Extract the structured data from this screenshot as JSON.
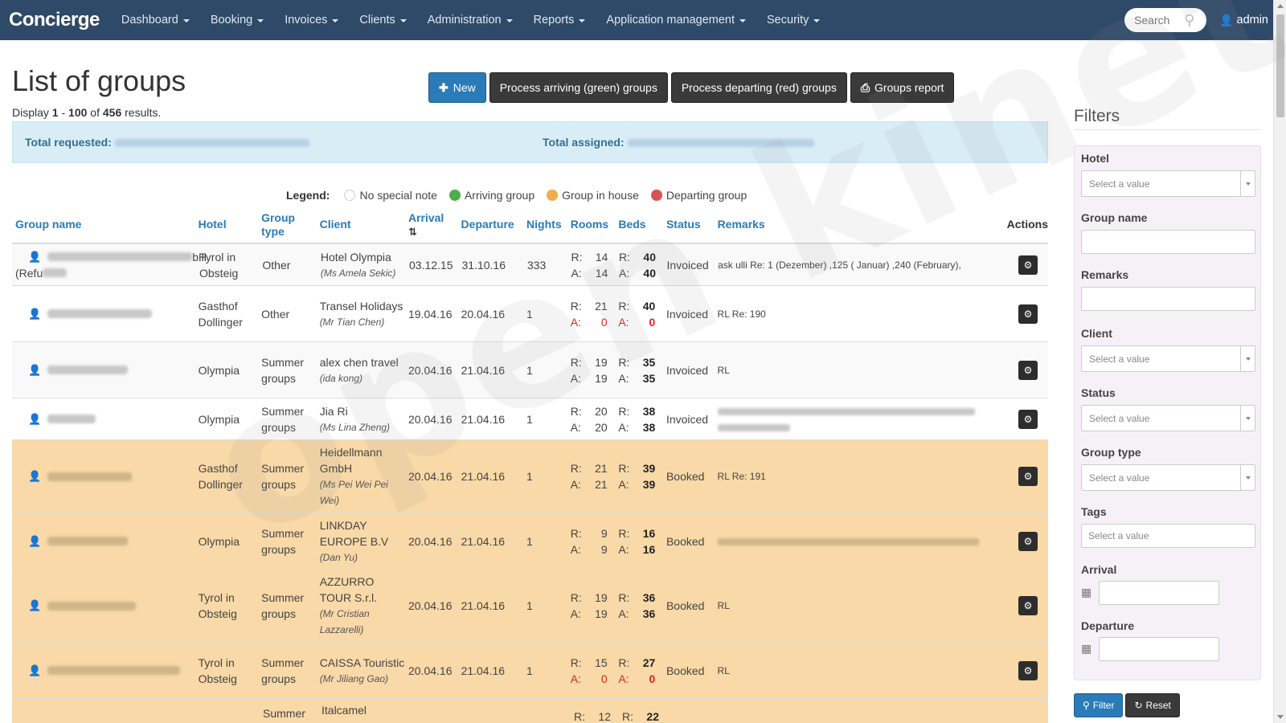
{
  "app": {
    "brand": "Concierge"
  },
  "nav": {
    "items": [
      {
        "label": "Dashboard"
      },
      {
        "label": "Booking"
      },
      {
        "label": "Invoices"
      },
      {
        "label": "Clients"
      },
      {
        "label": "Administration"
      },
      {
        "label": "Reports"
      },
      {
        "label": "Application management"
      },
      {
        "label": "Security"
      }
    ],
    "search_placeholder": "Search",
    "user": "admin"
  },
  "header": {
    "title": "List of groups",
    "results": {
      "prefix": "Display ",
      "from": "1",
      "dash": " - ",
      "to": "100",
      "of": " of ",
      "total": "456",
      "suffix": " results."
    },
    "buttons": {
      "new": "New",
      "arriving": "Process arriving (green) groups",
      "departing": "Process departing (red) groups",
      "report": "Groups report"
    }
  },
  "totals": {
    "requested_label": "Total requested:",
    "assigned_label": "Total assigned:"
  },
  "legend": {
    "label": "Legend:",
    "items": [
      {
        "label": "No special note",
        "color": "#ffffff"
      },
      {
        "label": "Arriving group",
        "color": "#4cae4c"
      },
      {
        "label": "Group in house",
        "color": "#f0ad4e"
      },
      {
        "label": "Departing group",
        "color": "#d9534f"
      }
    ]
  },
  "table": {
    "headers": {
      "name": "Group name",
      "hotel": "Hotel",
      "type": "Group type",
      "client": "Client",
      "arrival": "Arrival",
      "departure": "Departure",
      "nights": "Nights",
      "rooms": "Rooms",
      "beds": "Beds",
      "status": "Status",
      "remarks": "Remarks",
      "actions": "Actions"
    },
    "rows": [
      {
        "name_suffix": "bH",
        "name_line2": "(Refu",
        "hotel": "Tyrol in Obsteig",
        "type": "Other",
        "client": "Hotel Olympia",
        "contact": "(Ms Amela Sekic)",
        "arrival": "03.12.15",
        "departure": "31.10.16",
        "nights": "333",
        "rooms_r": "14",
        "rooms_a": "14",
        "beds_r": "40",
        "beds_a": "40",
        "status": "Invoiced",
        "remarks": "ask ulli Re: 1 (Dezember) ,125 ( Januar) ,240 (February),"
      },
      {
        "name_suffix": "",
        "name_line2": "",
        "hotel": "Gasthof Dollinger",
        "type": "Other",
        "client": "Transel Holidays",
        "contact": "(Mr Tian Chen)",
        "arrival": "19.04.16",
        "departure": "20.04.16",
        "nights": "1",
        "rooms_r": "21",
        "rooms_a": "0",
        "beds_r": "40",
        "beds_a": "0",
        "status": "Invoiced",
        "remarks": "RL Re: 190"
      },
      {
        "name_suffix": "",
        "name_line2": "",
        "hotel": "Olympia",
        "type": "Summer groups",
        "client": "alex chen travel",
        "contact": "(ida kong)",
        "arrival": "20.04.16",
        "departure": "21.04.16",
        "nights": "1",
        "rooms_r": "19",
        "rooms_a": "19",
        "beds_r": "35",
        "beds_a": "35",
        "status": "Invoiced",
        "remarks": "RL"
      },
      {
        "name_suffix": "",
        "name_line2": "",
        "hotel": "Olympia",
        "type": "Summer groups",
        "client": "Jia Ri",
        "contact": "(Ms Lina Zheng)",
        "arrival": "20.04.16",
        "departure": "21.04.16",
        "nights": "1",
        "rooms_r": "20",
        "rooms_a": "20",
        "beds_r": "38",
        "beds_a": "38",
        "status": "Invoiced",
        "remarks": ""
      },
      {
        "name_suffix": "",
        "name_line2": "",
        "hotel": "Gasthof Dollinger",
        "type": "Summer groups",
        "client": "Heidellmann GmbH",
        "contact": "(Ms Pei Wei Pei Wei)",
        "arrival": "20.04.16",
        "departure": "21.04.16",
        "nights": "1",
        "rooms_r": "21",
        "rooms_a": "21",
        "beds_r": "39",
        "beds_a": "39",
        "status": "Booked",
        "remarks": "RL Re: 191"
      },
      {
        "name_suffix": "",
        "name_line2": "",
        "hotel": "Olympia",
        "type": "Summer groups",
        "client": "LINKDAY EUROPE B.V",
        "contact": "(Dan Yu)",
        "arrival": "20.04.16",
        "departure": "21.04.16",
        "nights": "1",
        "rooms_r": "9",
        "rooms_a": "9",
        "beds_r": "16",
        "beds_a": "16",
        "status": "Booked",
        "remarks": ""
      },
      {
        "name_suffix": "",
        "name_line2": "",
        "hotel": "Tyrol in Obsteig",
        "type": "Summer groups",
        "client": "AZZURRO TOUR S.r.l.",
        "contact": "(Mr Cristian Lazzarelli)",
        "arrival": "20.04.16",
        "departure": "21.04.16",
        "nights": "1",
        "rooms_r": "19",
        "rooms_a": "19",
        "beds_r": "36",
        "beds_a": "36",
        "status": "Booked",
        "remarks": "RL"
      },
      {
        "name_suffix": "",
        "name_line2": "",
        "hotel": "Tyrol in Obsteig",
        "type": "Summer groups",
        "client": "CAISSA Touristic",
        "contact": "(Mr Jiliang Gao)",
        "arrival": "20.04.16",
        "departure": "21.04.16",
        "nights": "1",
        "rooms_r": "15",
        "rooms_a": "0",
        "beds_r": "27",
        "beds_a": "0",
        "status": "Booked",
        "remarks": "RL"
      },
      {
        "name_suffix": "",
        "name_line2": "",
        "hotel": "",
        "type": "Summer",
        "client": "Italcamel",
        "contact": "",
        "arrival": "",
        "departure": "",
        "nights": "",
        "rooms_r": "12",
        "rooms_a": "",
        "beds_r": "22",
        "beds_a": "",
        "status": "",
        "remarks": ""
      }
    ]
  },
  "filters": {
    "title": "Filters",
    "hotel_label": "Hotel",
    "hotel_placeholder": "Select a value",
    "group_name_label": "Group name",
    "remarks_label": "Remarks",
    "client_label": "Client",
    "client_placeholder": "Select a value",
    "status_label": "Status",
    "status_placeholder": "Select a value",
    "group_type_label": "Group type",
    "group_type_placeholder": "Select a value",
    "tags_label": "Tags",
    "tags_placeholder": "Select a value",
    "arrival_label": "Arrival",
    "departure_label": "Departure",
    "filter_button": "Filter",
    "reset_button": "Reset"
  }
}
